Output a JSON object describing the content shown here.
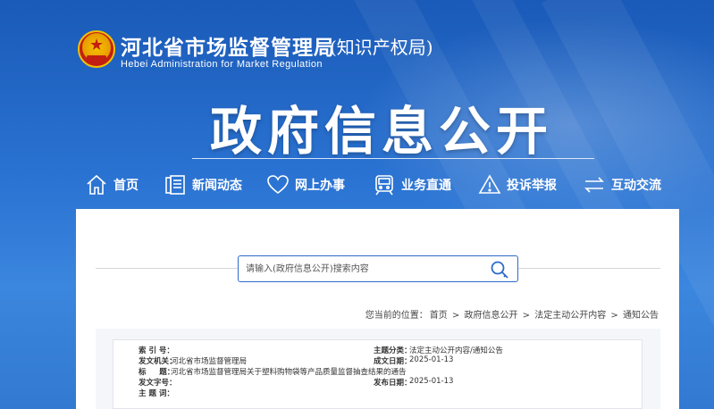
{
  "header": {
    "org_name_cn": "河北省市场监督管理局",
    "org_name_sub": "(知识产权局)",
    "org_name_en": "Hebei  Administration  for  Market  Regulation",
    "banner_title": "政府信息公开"
  },
  "nav": {
    "items": [
      {
        "label": "首页",
        "icon": "home-icon"
      },
      {
        "label": "新闻动态",
        "icon": "news-icon"
      },
      {
        "label": "网上办事",
        "icon": "heart-icon"
      },
      {
        "label": "业务直通",
        "icon": "train-icon"
      },
      {
        "label": "投诉举报",
        "icon": "warning-icon"
      },
      {
        "label": "互动交流",
        "icon": "exchange-icon"
      }
    ]
  },
  "search": {
    "placeholder": "请输入(政府信息公开)搜索内容"
  },
  "breadcrumb": {
    "prefix": "您当前的位置：",
    "items": [
      "首页",
      "政府信息公开",
      "法定主动公开内容",
      "通知公告"
    ],
    "separator": ">"
  },
  "meta": {
    "index_label": "索 引 号：",
    "index_value": "",
    "category_label": "主题分类：",
    "category_value": "法定主动公开内容/通知公告",
    "issuer_label": "发文机关：",
    "issuer_value": "河北省市场监督管理局",
    "created_label": "成文日期：",
    "created_value": "2025-01-13",
    "title_label": "标     题：",
    "title_value": "河北省市场监督管理局关于塑料购物袋等产品质量监督抽查结果的通告",
    "docno_label": "发文字号：",
    "docno_value": "",
    "published_label": "发布日期：",
    "published_value": "2025-01-13",
    "keywords_label": "主 题 词：",
    "keywords_value": ""
  },
  "colors": {
    "brand_blue": "#2b74d3",
    "search_border": "#2c6cc8"
  }
}
